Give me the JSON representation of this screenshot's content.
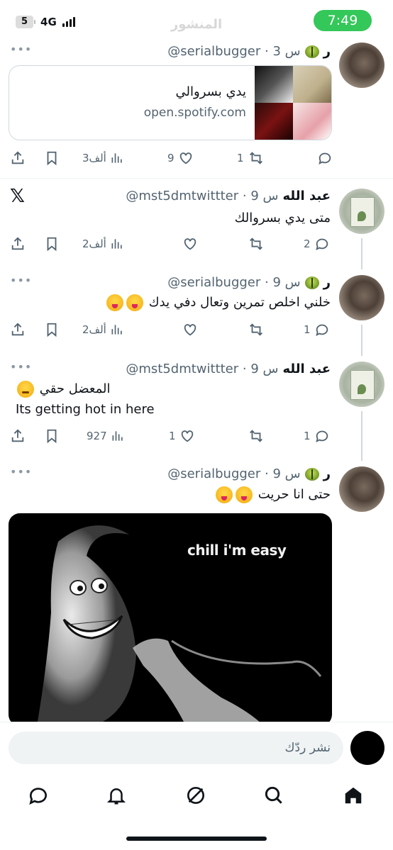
{
  "status_bar": {
    "battery": "5",
    "network": "4G",
    "time": "7:49"
  },
  "page_title_faded": "المنشور",
  "tweets": [
    {
      "name": "ر",
      "handle": "@serialbugger",
      "time": "3 س",
      "card": {
        "title": "يدي بسروالي",
        "domain": "open.spotify.com"
      },
      "replies": "",
      "retweets": "1",
      "likes": "9",
      "views": "3ألف"
    },
    {
      "name": "عبد الله",
      "handle": "@mst5dmtwittter",
      "time": "9 س",
      "text": "متى يدي بسروالك",
      "replies": "2",
      "retweets": "",
      "likes": "",
      "views": "2ألف"
    },
    {
      "name": "ر",
      "handle": "@serialbugger",
      "time": "9 س",
      "text": "خلني اخلص تمرين وتعال دفي يدك",
      "replies": "1",
      "retweets": "",
      "likes": "",
      "views": "2ألف"
    },
    {
      "name": "عبد الله",
      "handle": "@mst5dmtwittter",
      "time": "9 س",
      "text": "المعضل حقي",
      "text2": "Its getting hot in here",
      "replies": "1",
      "retweets": "",
      "likes": "1",
      "views": "927"
    },
    {
      "name": "ر",
      "handle": "@serialbugger",
      "time": "9 س",
      "text": "حتى انا حريت",
      "media_caption": "chill i'm easy"
    }
  ],
  "reply_bar": {
    "placeholder": "نشر ردّك"
  },
  "tabbar": [
    "home",
    "search",
    "grok",
    "notifications",
    "messages"
  ]
}
